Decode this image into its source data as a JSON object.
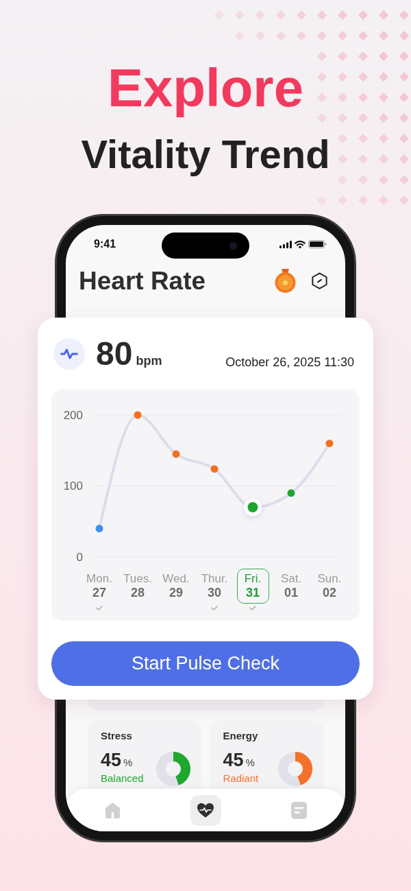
{
  "headline": {
    "title": "Explore",
    "subtitle": "Vitality Trend"
  },
  "status_bar": {
    "time": "9:41"
  },
  "screen": {
    "title": "Heart Rate"
  },
  "reading": {
    "value": "80",
    "unit": "bpm",
    "timestamp": "October 26, 2025 11:30"
  },
  "chart": {
    "chart_data": {
      "type": "line",
      "categories": [
        "Mon.",
        "Tues.",
        "Wed.",
        "Thur.",
        "Fri.",
        "Sat.",
        "Sun."
      ],
      "series": [
        {
          "color": "#dcdde9",
          "marker": true,
          "values": [
            40,
            200,
            145,
            124,
            70,
            90,
            160
          ]
        }
      ],
      "ylim": [
        0,
        200
      ],
      "yticks": [
        0,
        100,
        200
      ]
    },
    "days": [
      {
        "date": "27",
        "selected": false,
        "checked": true,
        "color": "#3b8ff0"
      },
      {
        "date": "28",
        "selected": false,
        "checked": false,
        "color": "#f56f1f"
      },
      {
        "date": "29",
        "selected": false,
        "checked": false,
        "color": "#f56f1f"
      },
      {
        "date": "30",
        "selected": false,
        "checked": true,
        "color": "#f56f1f"
      },
      {
        "date": "31",
        "selected": true,
        "checked": true,
        "color": "#1ea52d"
      },
      {
        "date": "01",
        "selected": false,
        "checked": false,
        "color": "#1ea52d"
      },
      {
        "date": "02",
        "selected": false,
        "checked": false,
        "color": "#f56f1f"
      }
    ]
  },
  "button": {
    "label": "Start Pulse Check"
  },
  "metrics": [
    {
      "label": "Stress",
      "value": "45",
      "unit": "%",
      "status": "Balanced",
      "color": "#1fa82e",
      "level": 0.45
    },
    {
      "label": "Energy",
      "value": "45",
      "unit": "%",
      "status": "Radiant",
      "color": "#f4712a",
      "level": 0.45
    }
  ],
  "nav_items": [
    {
      "kind": "home",
      "selected": false
    },
    {
      "kind": "heart",
      "selected": true
    },
    {
      "kind": "notes",
      "selected": false
    }
  ]
}
